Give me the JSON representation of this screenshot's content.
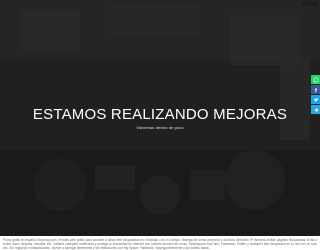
{
  "hero": {
    "title": "ESTAMOS REALIZANDO MEJORAS",
    "subtitle": "Volvemos dentro de poco",
    "brand_badge": "",
    "colors": {
      "overlay": "#000000",
      "title": "#ffffff"
    }
  },
  "social": [
    {
      "name": "whatsapp",
      "icon": "whatsapp-icon",
      "color": "#25d366"
    },
    {
      "name": "facebook",
      "icon": "facebook-icon",
      "color": "#3b5998"
    },
    {
      "name": "twitter",
      "icon": "twitter-icon",
      "color": "#1da1f2"
    },
    {
      "name": "telegram",
      "icon": "telegram-icon",
      "color": "#2ca5e0"
    }
  ],
  "body_text": "Proxy gratis en español Sinproxy.com. Proxies web gratis para acceder a sitios web bloqueados en el trabajo o en el colegio. Navega de forma anónima y oculta tu dirección IP mientras visitas páginas bloqueadas. Evita a redes como ninguna, escuela, etc. Saltarte cualquier restricción y protege tu privacidad en Internet con nuestro servicio de proxy. Desbloquea YouTube, Facebook, Twitter y cualquier sitio bloqueado en tu red con un solo clic. Sin registros ni instalaciones. Vuelve a navegar libremente y sin limitaciones con My Space, Facebook. Navega libremente y sin límites hasta."
}
